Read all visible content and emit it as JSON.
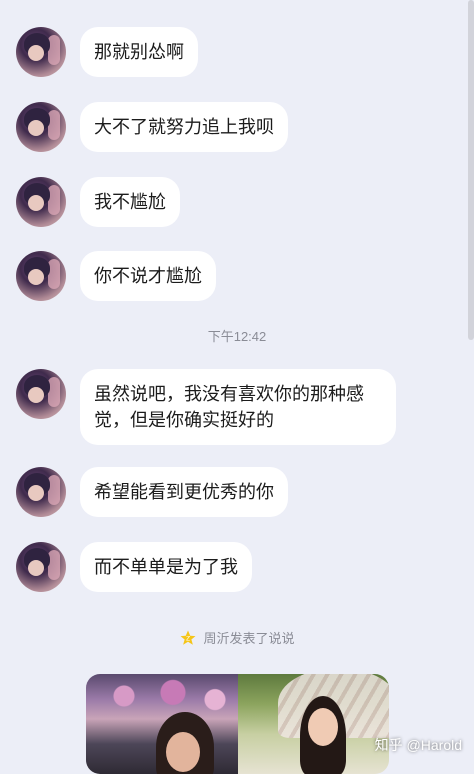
{
  "messages": [
    {
      "text": "那就别怂啊"
    },
    {
      "text": "大不了就努力追上我呗"
    },
    {
      "text": "我不尴尬"
    },
    {
      "text": "你不说才尴尬"
    },
    {
      "text": "虽然说吧，我没有喜欢你的那种感觉，但是你确实挺好的"
    },
    {
      "text": "希望能看到更优秀的你"
    },
    {
      "text": "而不单单是为了我"
    }
  ],
  "timestamp": "下午12:42",
  "notice": {
    "icon": "star-icon",
    "text": "周沂发表了说说"
  },
  "watermark": "知乎 @Harold",
  "colors": {
    "background": "#eceef7",
    "bubble": "#ffffff",
    "star": "#f5c518"
  }
}
